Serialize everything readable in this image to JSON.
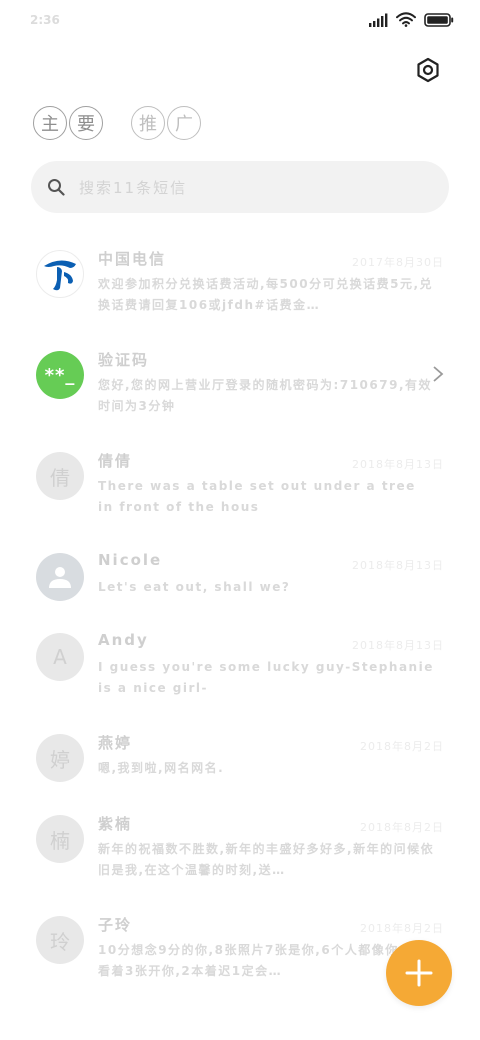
{
  "status_bar": {
    "time": "2:36"
  },
  "tabs": [
    {
      "chars": [
        "主",
        "要"
      ],
      "active": true
    },
    {
      "chars": [
        "推",
        "广"
      ],
      "active": false
    }
  ],
  "search": {
    "placeholder": "搜索11条短信"
  },
  "conversations": [
    {
      "name": "中国电信",
      "date": "2017年8月30日",
      "snippet": "欢迎参加积分兑换话费活动,每500分可兑换话费5元,兑换话费请回复106或jfdh#话费金…",
      "avatar_type": "logo",
      "avatar_text": ""
    },
    {
      "name": "验证码",
      "date": "",
      "snippet": "您好,您的网上营业厅登录的随机密码为:710679,有效时间为3分钟",
      "avatar_type": "code",
      "avatar_text": "**_"
    },
    {
      "name": "倩倩",
      "date": "2018年8月13日",
      "snippet": "There was a table set out under a tree in front of the hous",
      "avatar_type": "initial",
      "avatar_text": "倩"
    },
    {
      "name": "Nicole",
      "date": "2018年8月13日",
      "snippet": "Let's eat out, shall we?",
      "avatar_type": "person",
      "avatar_text": ""
    },
    {
      "name": "Andy",
      "date": "2018年8月13日",
      "snippet": "I guess you're some lucky guy-Stephanie is a nice girl-",
      "avatar_type": "initial",
      "avatar_text": "A"
    },
    {
      "name": "燕婷",
      "date": "2018年8月2日",
      "snippet": "嗯,我到啦,网名网名.",
      "avatar_type": "initial",
      "avatar_text": "婷"
    },
    {
      "name": "紫楠",
      "date": "2018年8月2日",
      "snippet": "新年的祝福数不胜数,新年的丰盛好多好多,新年的问候依旧是我,在这个温馨的时刻,送…",
      "avatar_type": "initial",
      "avatar_text": "楠"
    },
    {
      "name": "子玲",
      "date": "2018年8月2日",
      "snippet": "10分想念9分的你,8张照片7张是你,6个人都像你,4组看着3张开你,2本着迟1定会…",
      "avatar_type": "initial",
      "avatar_text": "玲"
    }
  ],
  "colors": {
    "fab": "#f5a935",
    "code_avatar": "#66cc55",
    "telecom_logo": "#0b5fb3"
  },
  "icons": [
    "signal-icon",
    "wifi-icon",
    "battery-icon",
    "settings-icon",
    "search-icon",
    "chevron-right-icon",
    "plus-icon"
  ]
}
